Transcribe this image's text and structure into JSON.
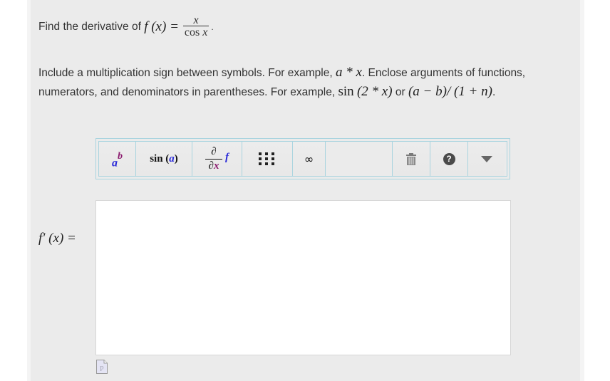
{
  "question": {
    "prompt": "Find the derivative of",
    "function_lhs": "f (x) =",
    "fraction": {
      "numerator": "x",
      "denominator_fn": "cos",
      "denominator_var": "x"
    },
    "end": "."
  },
  "instructions": {
    "p1": "Include a multiplication sign between symbols. For example,",
    "ex1": "a * x",
    "p2": ". Enclose arguments of functions, numerators, and denominators in parentheses. For example,",
    "ex2_fn": "sin",
    "ex2_arg": "(2 * x)",
    "p3": "or",
    "ex3": "(a − b)/ (1 + n)",
    "p4": "."
  },
  "toolbar": {
    "power": {
      "base": "a",
      "exp": "b",
      "icon": "power-icon"
    },
    "sin": {
      "fn": "sin",
      "arg": "a",
      "icon": "function-icon"
    },
    "derivative": {
      "top": "∂",
      "bottom_d": "∂",
      "bottom_x": "x",
      "func": "f",
      "icon": "derivative-icon"
    },
    "matrix": {
      "icon": "matrix-icon"
    },
    "infinity": {
      "symbol": "∞",
      "icon": "infinity-icon"
    },
    "trash": {
      "icon": "trash-icon"
    },
    "help": {
      "symbol": "?",
      "icon": "help-icon"
    },
    "more": {
      "icon": "triangle-down-icon"
    }
  },
  "answer": {
    "label": "f′ (x) =",
    "value": "",
    "preview_icon": "preview-document-icon"
  }
}
